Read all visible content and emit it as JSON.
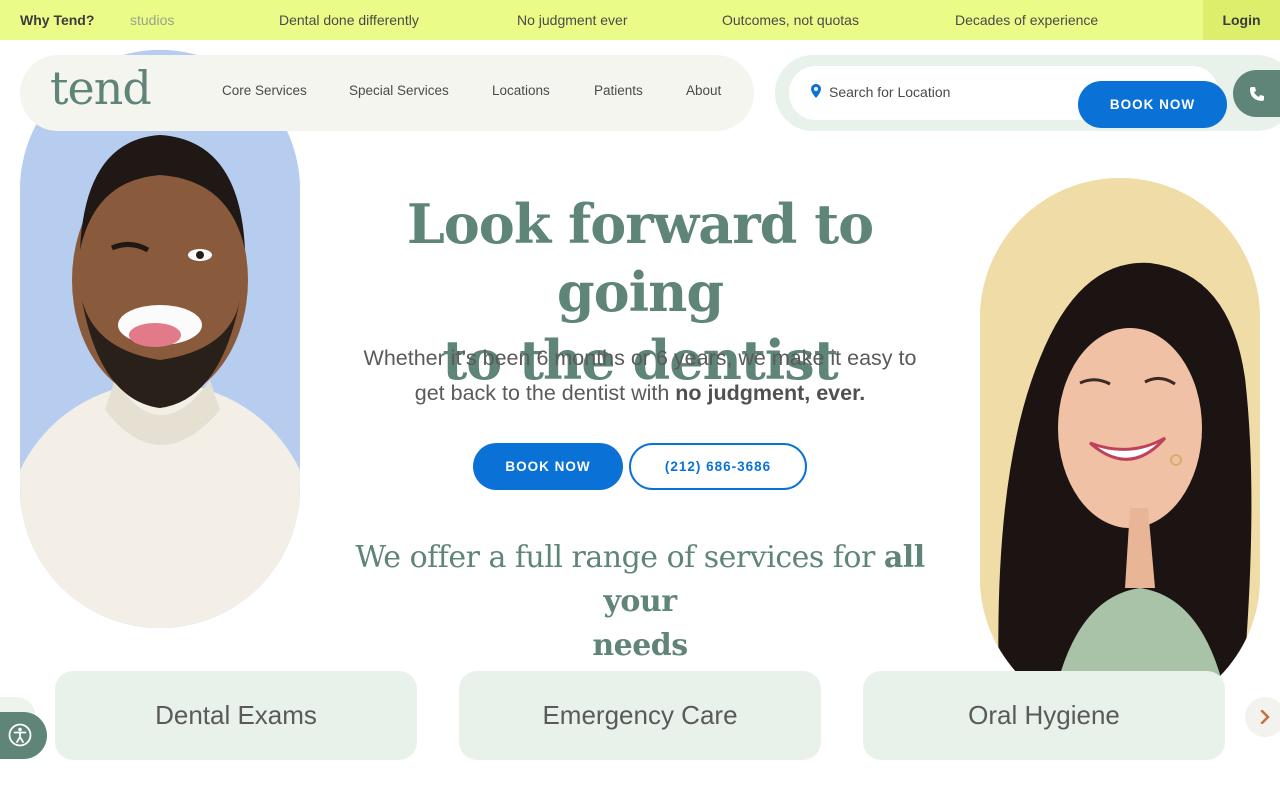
{
  "topbar": {
    "why_label": "Why Tend?",
    "items": [
      "studios",
      "Dental done differently",
      "No judgment ever",
      "Outcomes, not quotas",
      "Decades of experience"
    ],
    "login_label": "Login"
  },
  "header": {
    "logo_text": "tend",
    "nav": [
      "Core Services",
      "Special Services",
      "Locations",
      "Patients",
      "About"
    ],
    "search_placeholder": "Search for Location",
    "book_label": "BOOK NOW",
    "phone_icon": "phone-icon"
  },
  "hero": {
    "title_line1": "Look forward to going",
    "title_line2": "to the dentist",
    "subtitle_line1": "Whether it’s been 6 months or 6 years, we make it easy to",
    "subtitle_line2_pre": "get back to the dentist with ",
    "subtitle_line2_bold": "no judgment, ever.",
    "book_label": "BOOK NOW",
    "phone_label": "(212) 686-3686"
  },
  "services": {
    "heading_pre": "We offer a full range of services for ",
    "heading_bold1": "all your",
    "heading_bold2": "needs",
    "cards": [
      "Dental Exams",
      "Emergency Care",
      "Oral Hygiene"
    ]
  },
  "colors": {
    "accent_green": "#5f8478",
    "brand_blue": "#0a72d6",
    "topbar_yellow": "#eafc87",
    "card_bg": "#e8f1ea"
  }
}
